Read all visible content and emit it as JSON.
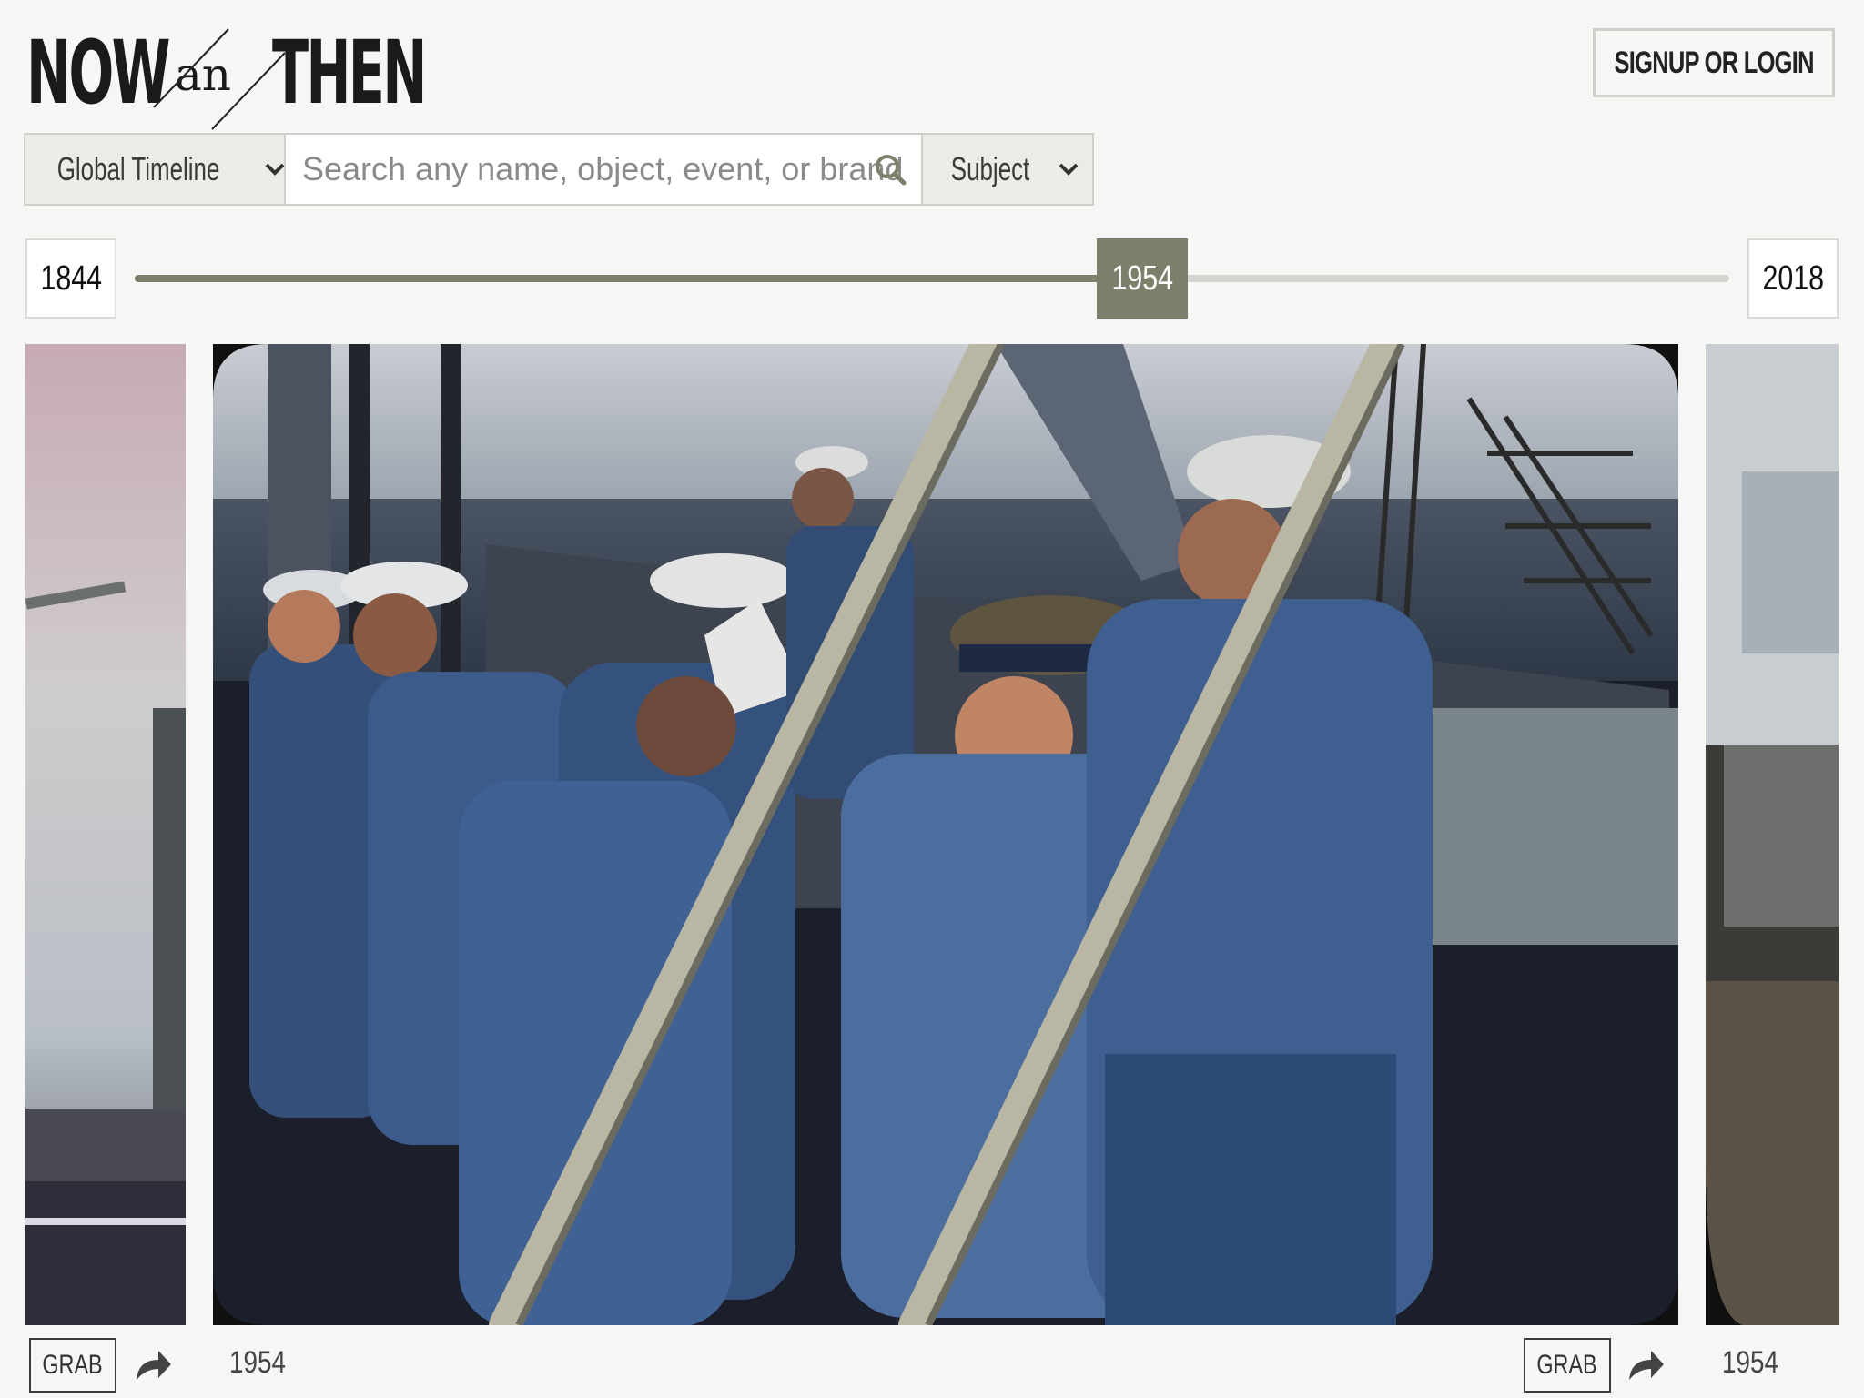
{
  "header": {
    "logo": {
      "now": "NOW",
      "an": "an",
      "then": "THEN"
    },
    "login_label": "SIGNUP OR LOGIN"
  },
  "search": {
    "timeline_label": "Global Timeline",
    "placeholder": "Search any name, object, event, or brand",
    "subject_label": "Subject"
  },
  "timeline": {
    "start_year": "1844",
    "end_year": "2018",
    "current_year": "1954",
    "progress_fraction": 0.632
  },
  "photos": {
    "left": {
      "year": ""
    },
    "main": {
      "year": "1954",
      "grab_label": "GRAB"
    },
    "right": {
      "year": "1954",
      "grab_label": "GRAB"
    }
  },
  "left_card": {
    "grab_label": "GRAB"
  },
  "colors": {
    "accent": "#7c806a",
    "background": "#f6f6f4",
    "border": "#cfcfcc"
  },
  "icons": [
    "search-icon",
    "chevron-down-icon",
    "share-icon"
  ]
}
